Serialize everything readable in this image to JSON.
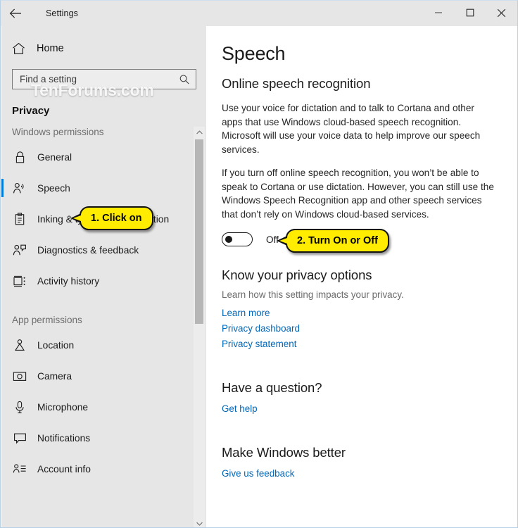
{
  "window": {
    "title": "Settings",
    "back_icon": "back-arrow-icon",
    "controls": [
      {
        "name": "minimize-button",
        "icon": "minimize-icon"
      },
      {
        "name": "maximize-button",
        "icon": "maximize-icon"
      },
      {
        "name": "close-button",
        "icon": "close-icon"
      }
    ]
  },
  "watermark": "TenForums.com",
  "sidebar": {
    "home_label": "Home",
    "home_icon": "home-icon",
    "search": {
      "placeholder": "Find a setting",
      "value": "",
      "icon": "search-icon"
    },
    "category_title": "Privacy",
    "groups": [
      {
        "heading": "Windows permissions",
        "items": [
          {
            "label": "General",
            "icon": "lock-icon",
            "selected": false
          },
          {
            "label": "Speech",
            "icon": "speech-person-icon",
            "selected": true
          },
          {
            "label": "Inking & typing personalization",
            "icon": "clipboard-pen-icon",
            "selected": false
          },
          {
            "label": "Diagnostics & feedback",
            "icon": "person-feedback-icon",
            "selected": false
          },
          {
            "label": "Activity history",
            "icon": "activity-history-icon",
            "selected": false
          }
        ]
      },
      {
        "heading": "App permissions",
        "items": [
          {
            "label": "Location",
            "icon": "location-pin-icon",
            "selected": false
          },
          {
            "label": "Camera",
            "icon": "camera-icon",
            "selected": false
          },
          {
            "label": "Microphone",
            "icon": "microphone-icon",
            "selected": false
          },
          {
            "label": "Notifications",
            "icon": "notification-bubble-icon",
            "selected": false
          },
          {
            "label": "Account info",
            "icon": "account-info-icon",
            "selected": false
          }
        ]
      }
    ],
    "scrollbar": {
      "up_arrow": "chevron-up-icon",
      "down_arrow": "chevron-down-icon"
    }
  },
  "main": {
    "page_title": "Speech",
    "section_title": "Online speech recognition",
    "paragraph_1": "Use your voice for dictation and to talk to Cortana and other apps that use Windows cloud-based speech recognition. Microsoft will use your voice data to help improve our speech services.",
    "paragraph_2": "If you turn off online speech recognition, you won’t be able to speak to Cortana or use dictation. However, you can still use the Windows Speech Recognition app and other speech services that don’t rely on Windows cloud-based services.",
    "toggle": {
      "state_label": "Off",
      "on": false
    },
    "privacy": {
      "heading": "Know your privacy options",
      "subtext": "Learn how this setting impacts your privacy.",
      "links": [
        "Learn more",
        "Privacy dashboard",
        "Privacy statement"
      ]
    },
    "question": {
      "heading": "Have a question?",
      "link": "Get help"
    },
    "better": {
      "heading": "Make Windows better",
      "link": "Give us feedback"
    }
  },
  "callouts": [
    {
      "text": "1. Click on"
    },
    {
      "text": "2. Turn On or Off"
    }
  ],
  "colors": {
    "accent": "#0078d7",
    "link": "#0067b8",
    "sidebar_bg": "#e6e6e6",
    "callout_bg": "#ffec00"
  }
}
